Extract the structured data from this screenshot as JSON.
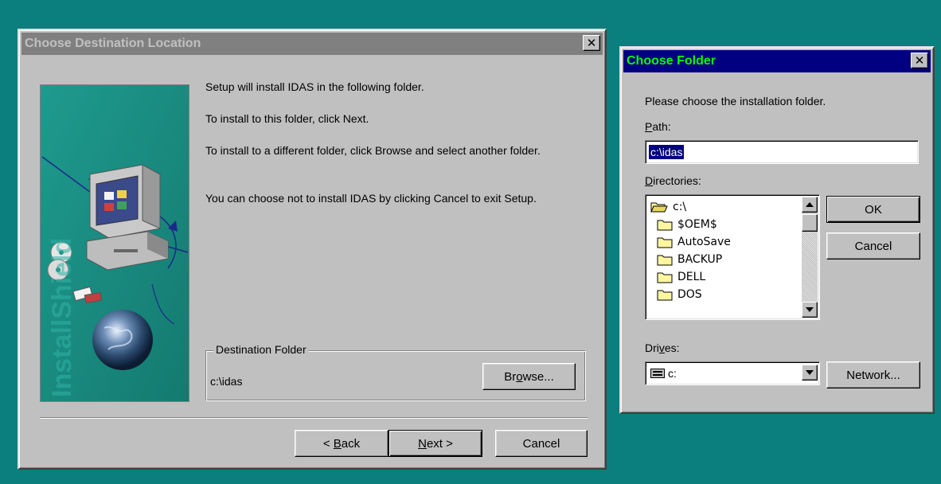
{
  "dest_dialog": {
    "title": "Choose Destination Location",
    "close_glyph": "✕",
    "banner_text": "InstallShield",
    "p1": "Setup will install IDAS in the following folder.",
    "p2": "To install to this folder, click Next.",
    "p3": "To install to a different folder, click Browse and select another folder.",
    "p4": "You can choose not to install IDAS by clicking Cancel to exit Setup.",
    "group_label": "Destination Folder",
    "folder_path": "c:\\idas",
    "browse_pre": "Br",
    "browse_ul": "o",
    "browse_post": "wse...",
    "back_pre": "< ",
    "back_ul": "B",
    "back_post": "ack",
    "next_ul": "N",
    "next_post": "ext >",
    "cancel_label": "Cancel"
  },
  "folder_dialog": {
    "title": "Choose Folder",
    "close_glyph": "✕",
    "instructions": "Please choose the installation folder.",
    "path_label_ul": "P",
    "path_label_post": "ath:",
    "path_value": "c:\\idas",
    "directories_label_ul": "D",
    "directories_label_post": "irectories:",
    "directories": [
      {
        "name": "c:\\",
        "icon": "open-folder-icon"
      },
      {
        "name": "$OEM$",
        "icon": "folder-icon"
      },
      {
        "name": "AutoSave",
        "icon": "folder-icon"
      },
      {
        "name": "BACKUP",
        "icon": "folder-icon"
      },
      {
        "name": "DELL",
        "icon": "folder-icon"
      },
      {
        "name": "DOS",
        "icon": "folder-icon"
      }
    ],
    "drives_label_pre": "Dri",
    "drives_label_ul": "v",
    "drives_label_post": "es:",
    "drive_value": "c:",
    "ok_label": "OK",
    "cancel_label": "Cancel",
    "network_label": "Network..."
  },
  "colors": {
    "desktop": "#0b7e7e",
    "window_face": "#c0c0c0",
    "active_title": "#000080",
    "active_title_text": "#00ff00",
    "inactive_title": "#808080",
    "banner_teal": "#1a8f83"
  }
}
